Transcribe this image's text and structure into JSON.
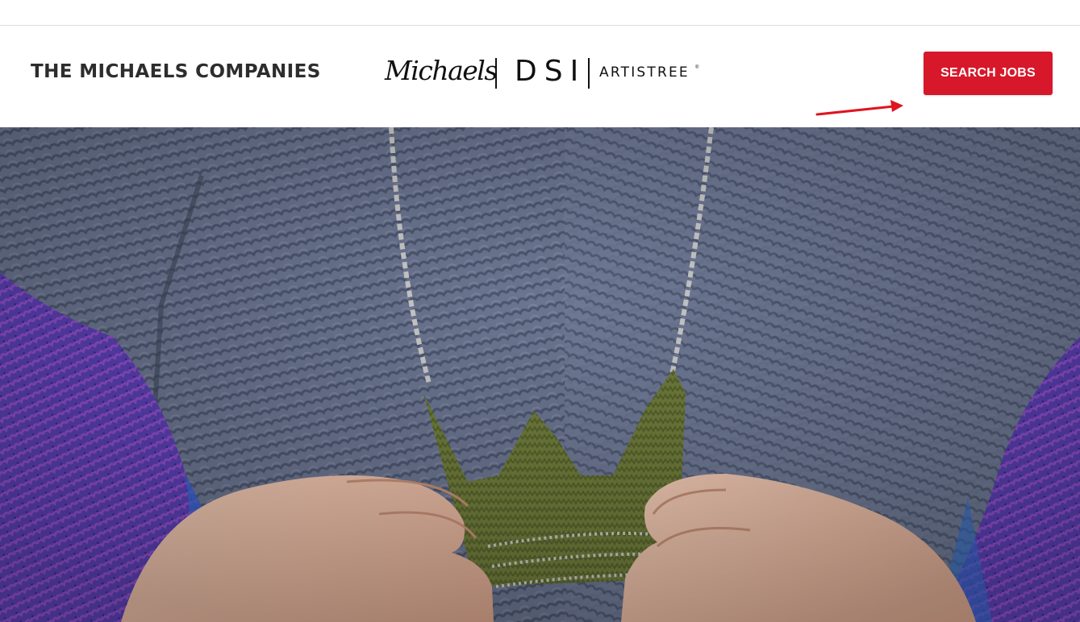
{
  "header": {
    "company_name": "THE MICHAELS COMPANIES",
    "brands": {
      "michaels": "Michaels",
      "dsi": "DSI",
      "artistree": "ARTISTREE",
      "registered_mark": "®"
    },
    "search_jobs_label": "SEARCH JOBS"
  },
  "hero": {
    "image_subject": "person in knitted sweater holding crocheted crown necklace"
  },
  "colors": {
    "accent_red": "#d7182a",
    "company_text": "#2d2d2d",
    "sweater_gray": "#6e7792",
    "sleeve_purple": "#5a3fb0",
    "crown_green": "#6e7a3a"
  }
}
